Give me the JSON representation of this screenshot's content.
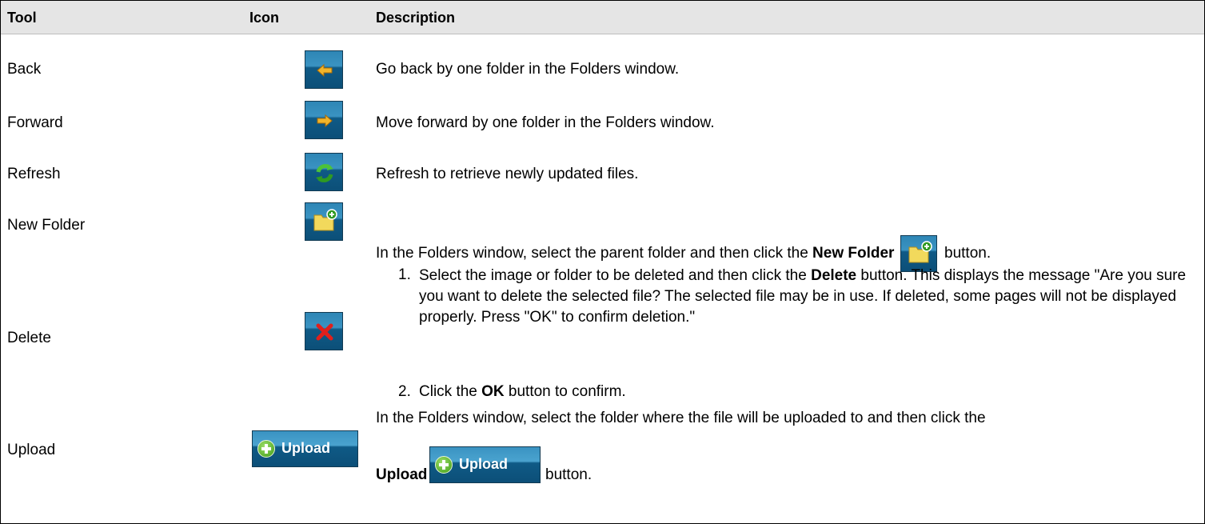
{
  "header": {
    "tool": "Tool",
    "icon": "Icon",
    "description": "Description"
  },
  "rows": [
    {
      "tool": "Back",
      "icon": "back-arrow-icon",
      "description": "Go back by one folder in the Folders window."
    },
    {
      "tool": "Forward",
      "icon": "forward-arrow-icon",
      "description": "Move forward by one folder in the Folders window."
    },
    {
      "tool": "Refresh",
      "icon": "refresh-icon",
      "description": "Refresh to retrieve newly updated files."
    },
    {
      "tool": "New Folder",
      "icon": "new-folder-icon",
      "desc_pre": "In the Folders window, select the parent folder and then click the ",
      "desc_bold": "New Folder",
      "desc_post": " button."
    },
    {
      "tool": "Delete",
      "icon": "delete-x-icon",
      "steps": [
        {
          "num": "1.",
          "pre": "Select the image or folder to be deleted and then click the ",
          "bold": "Delete",
          "post": " button. This displays the message \"Are you sure you want to delete the selected file? The selected file may be in use. If deleted, some pages will not be displayed properly. Press \"OK\" to confirm deletion.\""
        },
        {
          "num": "2.",
          "pre": "Click the ",
          "bold": "OK",
          "post": " button to confirm."
        }
      ]
    },
    {
      "tool": "Upload",
      "icon": "upload-icon",
      "button_label": "Upload",
      "desc_pre": "In the Folders window, select the folder where the file will be uploaded to and then click the",
      "desc_bold": "Upload",
      "desc_post": "button."
    }
  ],
  "colors": {
    "header_bg": "#e5e5e5",
    "icon_blue": "#0f5a86",
    "folder_yellow": "#f2d95c",
    "arrow_orange": "#e8a317",
    "delete_red": "#e0201c",
    "refresh_green": "#3fae2a"
  }
}
